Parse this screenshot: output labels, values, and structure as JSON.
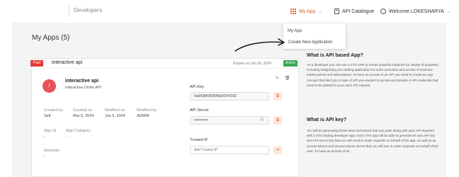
{
  "nav": {
    "brand": "Developers",
    "my_app": "My App",
    "api_catalogue": "API Catalogue",
    "user": "Welcome LOKESHARYA",
    "chevron": "⌄"
  },
  "dropdown": {
    "items": [
      "My App",
      "Create New Application"
    ]
  },
  "page": {
    "title": "My Apps (5)"
  },
  "card": {
    "badge": "Paid",
    "title": "interactive api",
    "expires": "Expires on Jun 30, 2024",
    "status": "Active",
    "avatar_letter": "I",
    "app_name": "interactive api",
    "app_type": "Interactive Order API",
    "meta": {
      "created_by_label": "Created by",
      "created_by": "Self",
      "created_on_label": "Created on",
      "created_on": "Mar 5, 2024",
      "modified_on_label": "Modified on",
      "modified_on": "Jun 6, 2024",
      "modified_by_label": "Modified by",
      "modified_by": "ADMIN",
      "algo_id_label": "Algo Id",
      "algo_id": "-",
      "algo_category_label": "Algo Category",
      "algo_category": "-",
      "remarks_label": "Remarks",
      "remarks": "-"
    },
    "api_key_label": "API Key",
    "api_key": "5a64384260549a007ef192",
    "api_secret_label": "API Secret",
    "api_secret": "•••••••••••",
    "trusted_ip_label": "Trusted IP",
    "trusted_ip_placeholder": "Add Trusted IP"
  },
  "panel": {
    "h1": "What is API based App?",
    "p1": "As a developer you can use a XTS APIs to create powerful solutions for variety of purposes, including integrating your trading application for order execution and access of real-time market prices and informations. To have an access of an API you need to create an App concept that bind you to type of API you wanted to access and provide a API credential that need to be passed in your each API request.",
    "h2": "What is API key?",
    "p2": "You will be generating these keys and tokens that you pass along with your API requests with a XTS trading developer app. Each XTS app will be able to generate its own API key and API secret key that you will need to make requests on behalf of the app, as well as an access tokens and access tokens secret that you will use to make requests on behalf of the user. To have an access of an"
  },
  "colors": {
    "accent": "#e8602c",
    "paid": "#e53935",
    "active": "#3aa655",
    "avatar": "#e9525a"
  },
  "icons": [
    "grid-icon",
    "book-icon",
    "user-icon",
    "edit-icon",
    "delete-icon",
    "copy-icon",
    "eye-off-icon",
    "arrow-right-icon"
  ]
}
